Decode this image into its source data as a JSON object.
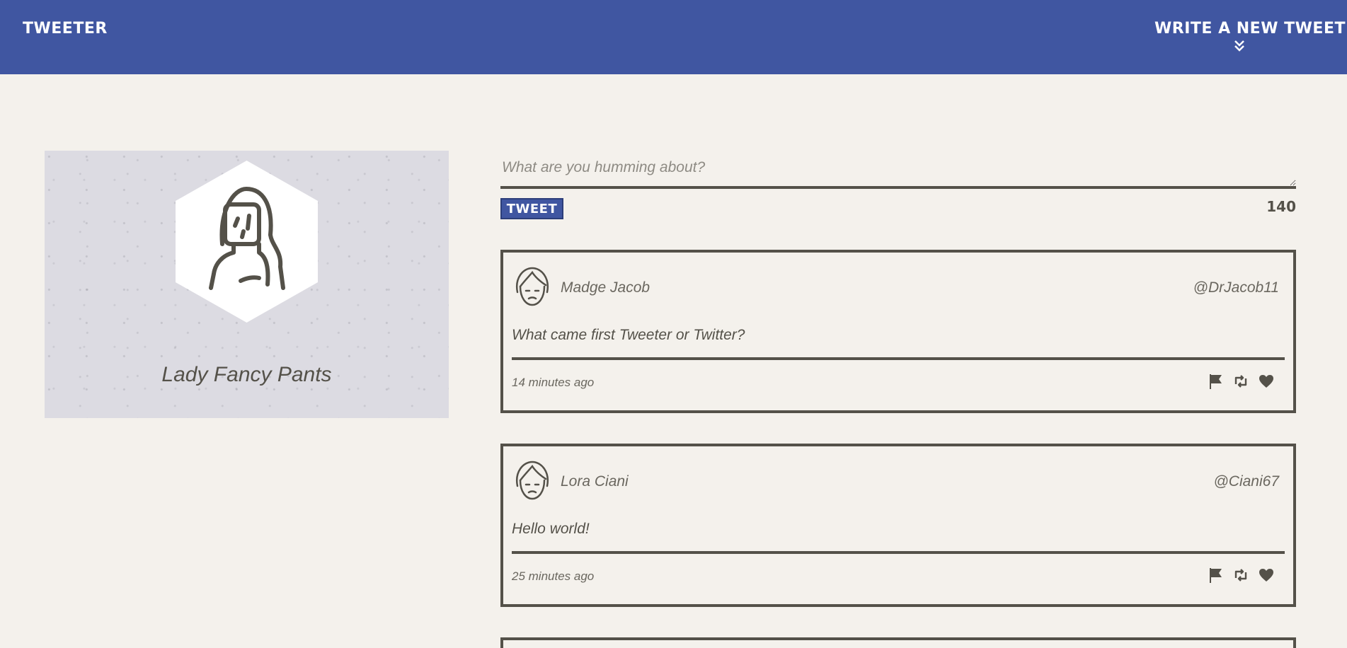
{
  "header": {
    "brand": "TWEETER",
    "compose_label": "WRITE A NEW TWEET"
  },
  "profile": {
    "name": "Lady Fancy Pants"
  },
  "composer": {
    "placeholder": "What are you humming about?",
    "button_label": "TWEET",
    "char_count": "140"
  },
  "tweets": [
    {
      "author": "Madge Jacob",
      "handle": "@DrJacob11",
      "text": "What came first Tweeter or Twitter?",
      "time": "14 minutes ago"
    },
    {
      "author": "Lora Ciani",
      "handle": "@Ciani67",
      "text": "Hello world!",
      "time": "25 minutes ago"
    }
  ],
  "colors": {
    "navbar": "#4056a1",
    "background": "#f4f1ec",
    "text": "#545149"
  },
  "icons": [
    "chevron-double-down-icon",
    "user-outline-icon",
    "flag-icon",
    "retweet-icon",
    "heart-icon"
  ]
}
